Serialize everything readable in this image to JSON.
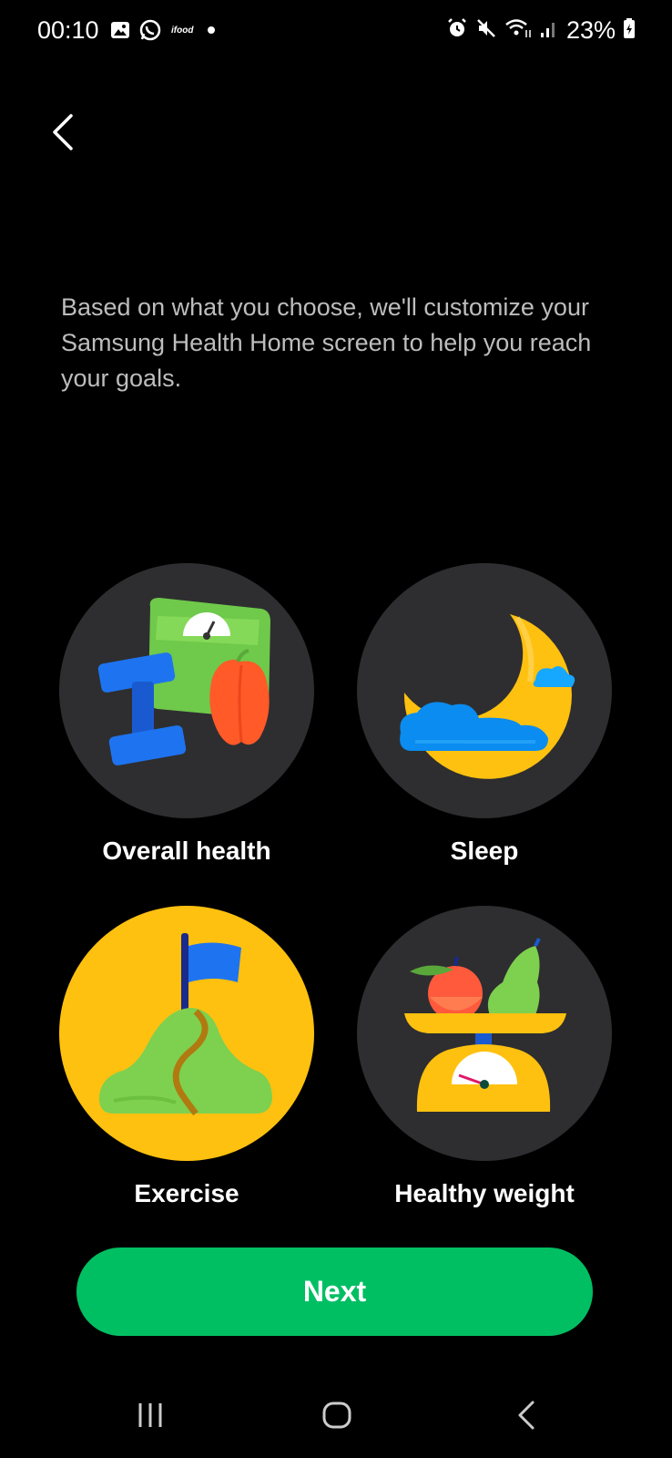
{
  "status_bar": {
    "time": "00:10",
    "notification_icons": [
      "gallery-icon",
      "whatsapp-icon",
      "ifood-icon",
      "dot-icon"
    ],
    "system_icons": [
      "alarm-icon",
      "mute-icon",
      "wifi-icon",
      "signal-icon",
      "battery-charging-icon"
    ],
    "battery": "23%"
  },
  "header": {
    "back_icon": "chevron-left-icon"
  },
  "description": "Based on what you choose, we'll customize your Samsung Health Home screen to help you reach your goals.",
  "goals": [
    {
      "label": "Overall health",
      "icon": "overall-health-illustration",
      "selected": false
    },
    {
      "label": "Sleep",
      "icon": "sleep-illustration",
      "selected": false
    },
    {
      "label": "Exercise",
      "icon": "exercise-illustration",
      "selected": true
    },
    {
      "label": "Healthy weight",
      "icon": "healthy-weight-illustration",
      "selected": false
    }
  ],
  "next_button": "Next",
  "colors": {
    "background": "#000000",
    "tile": "#2e2e30",
    "selected_tile": "#ffc10f",
    "accent": "#00bf63",
    "description_text": "#bdbdbd"
  },
  "nav_bar": {
    "items": [
      "recent-apps-icon",
      "home-icon",
      "back-icon"
    ]
  }
}
